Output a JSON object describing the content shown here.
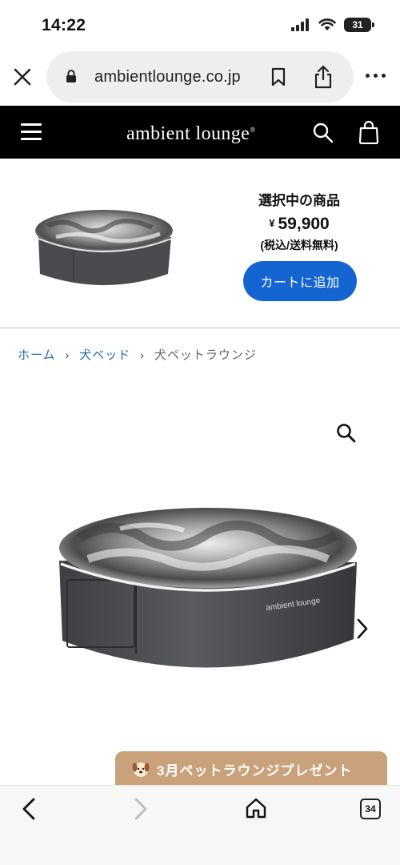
{
  "status": {
    "time": "14:22",
    "battery": "31"
  },
  "browser": {
    "url": "ambientlounge.co.jp",
    "tab_count": "34"
  },
  "header": {
    "logo": "ambient lounge",
    "logo_mark": "®"
  },
  "selected_product": {
    "title": "選択中の商品",
    "currency": "¥",
    "price": "59,900",
    "tax_note": "(税込/送料無料)",
    "cart_button": "カートに追加"
  },
  "breadcrumb": {
    "home": "ホーム",
    "category": "犬ベッド",
    "current": "犬ペットラウンジ",
    "separator": "›"
  },
  "product": {
    "label_text": "ambient lounge"
  },
  "promo": {
    "label": "3月ペットラウンジプレゼント"
  },
  "colors": {
    "accent_blue": "#1464d2",
    "link_blue": "#1a6fb0",
    "promo_tan": "#c9a27c",
    "header_black": "#000000"
  }
}
